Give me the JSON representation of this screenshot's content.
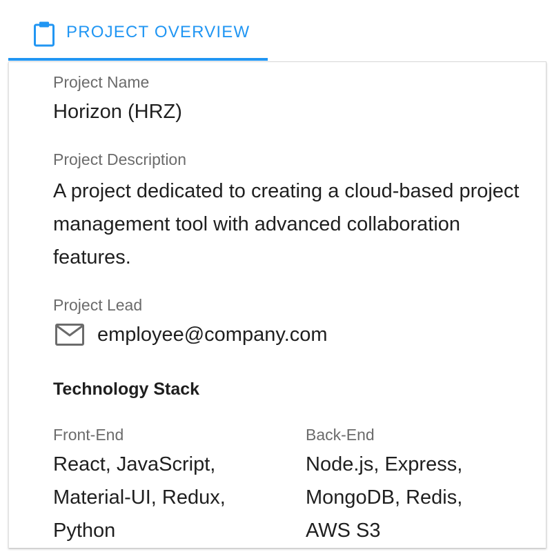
{
  "tab": {
    "label": "PROJECT OVERVIEW",
    "icon": "clipboard-icon",
    "accent_color": "#2196f3"
  },
  "project": {
    "name_label": "Project Name",
    "name": "Horizon (HRZ)",
    "description_label": "Project Description",
    "description": "A project dedicated to creating a cloud-based project management tool with advanced collaboration features.",
    "lead_label": "Project Lead",
    "lead_icon": "mail-icon",
    "lead_email": "employee@company.com"
  },
  "tech_stack": {
    "title": "Technology Stack",
    "front_end_label": "Front-End",
    "front_end": "React, JavaScript, Material-UI, Redux, Python",
    "back_end_label": "Back-End",
    "back_end": "Node.js, Express, MongoDB, Redis, AWS S3"
  }
}
